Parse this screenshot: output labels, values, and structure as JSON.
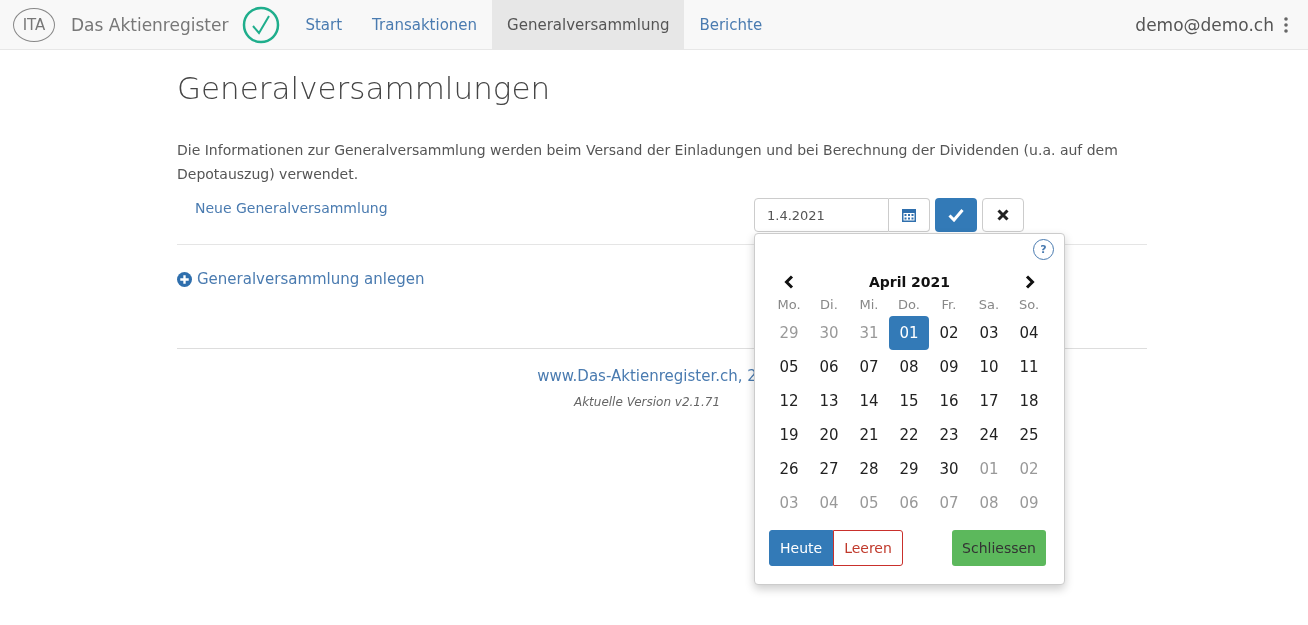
{
  "navbar": {
    "logo": "ITA",
    "brand": "Das Aktienregister",
    "user": "demo@demo.ch",
    "items": [
      {
        "label": "Start",
        "selected": false
      },
      {
        "label": "Transaktionen",
        "selected": false
      },
      {
        "label": "Generalversammlung",
        "selected": true
      },
      {
        "label": "Berichte",
        "selected": false
      }
    ]
  },
  "title": "Generalversammlungen",
  "intro": "Die Informationen zur Generalversammlung werden beim Versand der Einladungen und bei Berechnung der Dividenden (u.a. auf dem Depotauszug) verwendet.",
  "new_row": {
    "label": "Neue Generalversammlung",
    "date": "1.4.2021"
  },
  "create_link": "Generalversammlung anlegen",
  "footer": {
    "link": "www.Das-Aktienregister.ch, 2",
    "version": "Aktuelle Version v2.1.71"
  },
  "datepicker": {
    "help": "?",
    "month": "April 2021",
    "weekdays": [
      "Mo.",
      "Di.",
      "Mi.",
      "Do.",
      "Fr.",
      "Sa.",
      "So."
    ],
    "days": [
      {
        "label": "29",
        "kind": "other",
        "selected": false
      },
      {
        "label": "30",
        "kind": "other",
        "selected": false
      },
      {
        "label": "31",
        "kind": "other",
        "selected": false
      },
      {
        "label": "01",
        "kind": "current",
        "selected": true
      },
      {
        "label": "02",
        "kind": "current",
        "selected": false
      },
      {
        "label": "03",
        "kind": "current",
        "selected": false
      },
      {
        "label": "04",
        "kind": "current",
        "selected": false
      },
      {
        "label": "05",
        "kind": "current",
        "selected": false
      },
      {
        "label": "06",
        "kind": "current",
        "selected": false
      },
      {
        "label": "07",
        "kind": "current",
        "selected": false
      },
      {
        "label": "08",
        "kind": "current",
        "selected": false
      },
      {
        "label": "09",
        "kind": "current",
        "selected": false
      },
      {
        "label": "10",
        "kind": "current",
        "selected": false
      },
      {
        "label": "11",
        "kind": "current",
        "selected": false
      },
      {
        "label": "12",
        "kind": "current",
        "selected": false
      },
      {
        "label": "13",
        "kind": "current",
        "selected": false
      },
      {
        "label": "14",
        "kind": "current",
        "selected": false
      },
      {
        "label": "15",
        "kind": "current",
        "selected": false
      },
      {
        "label": "16",
        "kind": "current",
        "selected": false
      },
      {
        "label": "17",
        "kind": "current",
        "selected": false
      },
      {
        "label": "18",
        "kind": "current",
        "selected": false
      },
      {
        "label": "19",
        "kind": "current",
        "selected": false
      },
      {
        "label": "20",
        "kind": "current",
        "selected": false
      },
      {
        "label": "21",
        "kind": "current",
        "selected": false
      },
      {
        "label": "22",
        "kind": "current",
        "selected": false
      },
      {
        "label": "23",
        "kind": "current",
        "selected": false
      },
      {
        "label": "24",
        "kind": "current",
        "selected": false
      },
      {
        "label": "25",
        "kind": "current",
        "selected": false
      },
      {
        "label": "26",
        "kind": "current",
        "selected": false
      },
      {
        "label": "27",
        "kind": "current",
        "selected": false
      },
      {
        "label": "28",
        "kind": "current",
        "selected": false
      },
      {
        "label": "29",
        "kind": "current",
        "selected": false
      },
      {
        "label": "30",
        "kind": "current",
        "selected": false
      },
      {
        "label": "01",
        "kind": "other",
        "selected": false
      },
      {
        "label": "02",
        "kind": "other",
        "selected": false
      },
      {
        "label": "03",
        "kind": "other",
        "selected": false
      },
      {
        "label": "04",
        "kind": "other",
        "selected": false
      },
      {
        "label": "05",
        "kind": "other",
        "selected": false
      },
      {
        "label": "06",
        "kind": "other",
        "selected": false
      },
      {
        "label": "07",
        "kind": "other",
        "selected": false
      },
      {
        "label": "08",
        "kind": "other",
        "selected": false
      },
      {
        "label": "09",
        "kind": "other",
        "selected": false
      }
    ],
    "buttons": {
      "today": "Heute",
      "clear": "Leeren",
      "close": "Schliessen"
    }
  }
}
